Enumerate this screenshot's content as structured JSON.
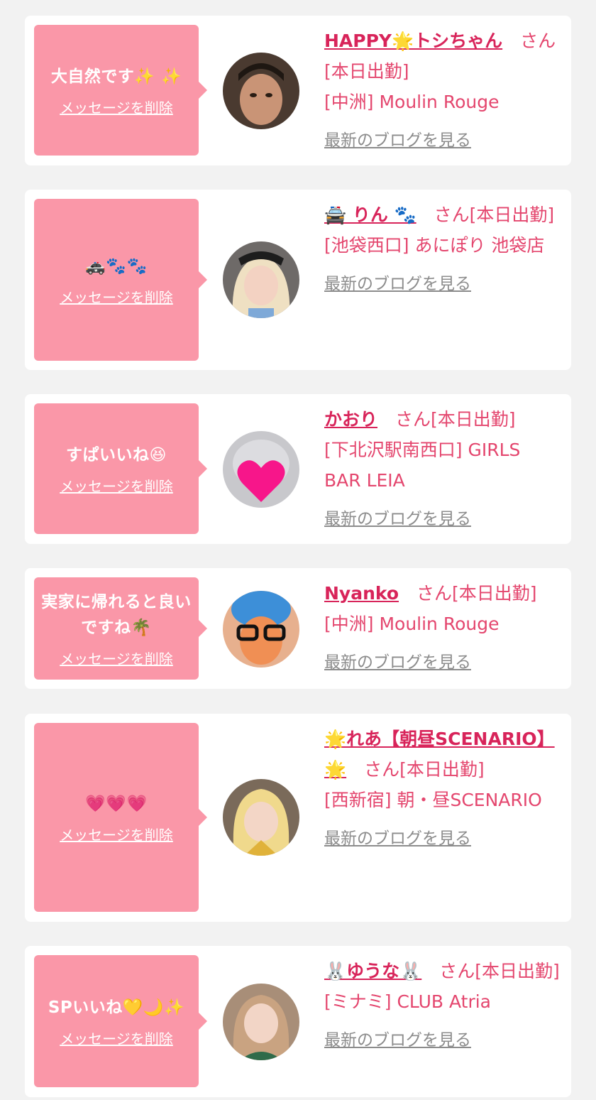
{
  "cards": [
    {
      "message": "大自然です✨ ✨",
      "delete_label": "メッセージを削除",
      "name": "HAPPY🌟トシちゃん",
      "suffix": "　さん[本日出勤]",
      "shop": "[中洲] Moulin Rouge",
      "blog_label": "最新のブログを見る"
    },
    {
      "message": "🚓🐾🐾",
      "delete_label": "メッセージを削除",
      "name": "🚔 りん 🐾",
      "suffix": "　さん[本日出勤]",
      "shop": "[池袋西口] あにぽり 池袋店",
      "blog_label": "最新のブログを見る"
    },
    {
      "message": "すぱいいね😆",
      "delete_label": "メッセージを削除",
      "name": "かおり",
      "suffix": "　さん[本日出勤]",
      "shop": "[下北沢駅南西口] GIRLS BAR LEIA",
      "blog_label": "最新のブログを見る"
    },
    {
      "message": "実家に帰れると良いですね🌴",
      "delete_label": "メッセージを削除",
      "name": "Nyanko",
      "suffix": "　さん[本日出勤]",
      "shop": "[中洲] Moulin Rouge",
      "blog_label": "最新のブログを見る"
    },
    {
      "message": "💗💗💗",
      "delete_label": "メッセージを削除",
      "name": "🌟れあ【朝昼SCENARIO】🌟",
      "suffix": "　さん[本日出勤]",
      "shop": "[西新宿] 朝・昼SCENARIO",
      "blog_label": "最新のブログを見る"
    },
    {
      "message": "SPいいね💛🌙✨",
      "delete_label": "メッセージを削除",
      "name": "🐰ゆうな🐰",
      "suffix": "　さん[本日出勤]",
      "shop": "[ミナミ] CLUB Atria",
      "blog_label": "最新のブログを見る"
    }
  ]
}
